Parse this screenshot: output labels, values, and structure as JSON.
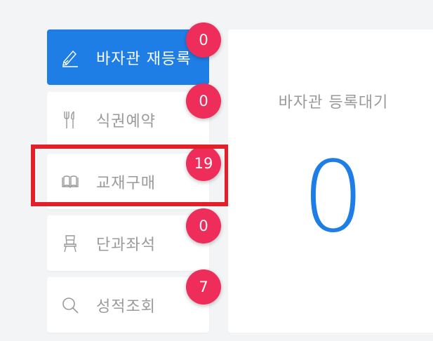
{
  "menu": {
    "items": [
      {
        "label": "바자관 재등록",
        "badge": "0",
        "icon": "pencil-icon",
        "active": true
      },
      {
        "label": "식권예약",
        "badge": "0",
        "icon": "utensils-icon",
        "active": false
      },
      {
        "label": "교재구매",
        "badge": "19",
        "icon": "book-icon",
        "active": false
      },
      {
        "label": "단과좌석",
        "badge": "0",
        "icon": "chair-icon",
        "active": false
      },
      {
        "label": "성적조회",
        "badge": "7",
        "icon": "search-icon",
        "active": false
      }
    ]
  },
  "panel": {
    "title": "바자관 등록대기",
    "count": "0"
  },
  "colors": {
    "accent": "#1f7ee6",
    "badge": "#ee2d5a",
    "highlight": "#e3202a"
  }
}
